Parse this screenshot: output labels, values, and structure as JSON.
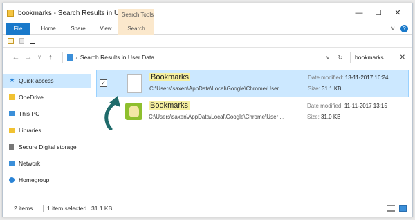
{
  "window": {
    "title": "bookmarks - Search Results in User...",
    "context_tab_header": "Search Tools",
    "controls": {
      "minimize": "—",
      "maximize": "☐",
      "close": "✕"
    }
  },
  "ribbon": {
    "tabs": [
      "File",
      "Home",
      "Share",
      "View",
      "Search"
    ],
    "expand_icon": "∨"
  },
  "address_bar": {
    "path": "Search Results in User Data",
    "back_icon": "←",
    "forward_icon": "→",
    "recent_icon": "∨",
    "up_icon": "↑",
    "dropdown_icon": "∨",
    "refresh_icon": "↻"
  },
  "search": {
    "value": "bookmarks",
    "clear_icon": "✕"
  },
  "sidebar": {
    "items": [
      {
        "label": "Quick access",
        "icon": "star-icon"
      },
      {
        "label": "OneDrive",
        "icon": "folder-icon"
      },
      {
        "label": "This PC",
        "icon": "computer-icon"
      },
      {
        "label": "Libraries",
        "icon": "folder-icon"
      },
      {
        "label": "Secure Digital storage",
        "icon": "drive-icon"
      },
      {
        "label": "Network",
        "icon": "network-icon"
      },
      {
        "label": "Homegroup",
        "icon": "homegroup-icon"
      }
    ]
  },
  "results": [
    {
      "name": "Bookmarks",
      "path": "C:\\Users\\saxen\\AppData\\Local\\Google\\Chrome\\User ...",
      "modified_label": "Date modified:",
      "modified": "13-11-2017 16:24",
      "size_label": "Size:",
      "size": "31.1 KB",
      "checked": "✓"
    },
    {
      "name": "Bookmarks",
      "path": "C:\\Users\\saxen\\AppData\\Local\\Google\\Chrome\\User ...",
      "modified_label": "Date modified:",
      "modified": "11-11-2017 13:15",
      "size_label": "Size:",
      "size": "31.0 KB"
    }
  ],
  "status": {
    "items_count": "2 items",
    "selected": "1 item selected",
    "selected_size": "31.1 KB"
  },
  "colors": {
    "accent": "#1979ca",
    "selection": "#cce8ff",
    "highlight": "#f6f0a0",
    "arrow": "#1f6b6b"
  }
}
